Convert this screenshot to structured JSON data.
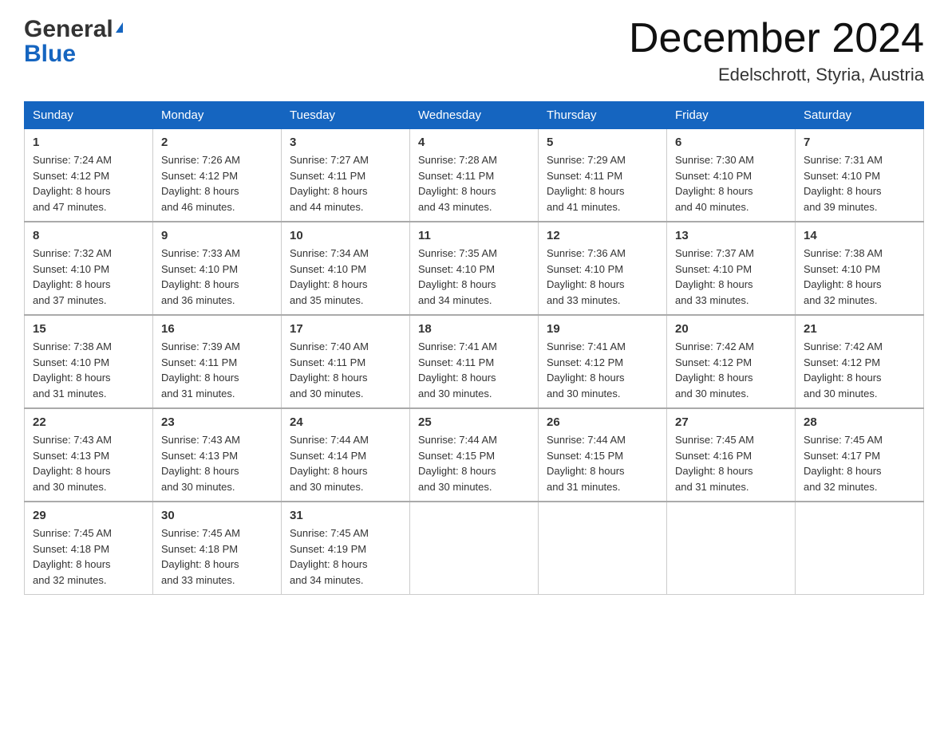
{
  "header": {
    "title": "December 2024",
    "subtitle": "Edelschrott, Styria, Austria",
    "logo_general": "General",
    "logo_blue": "Blue"
  },
  "days_of_week": [
    "Sunday",
    "Monday",
    "Tuesday",
    "Wednesday",
    "Thursday",
    "Friday",
    "Saturday"
  ],
  "weeks": [
    [
      {
        "day": "1",
        "sunrise": "7:24 AM",
        "sunset": "4:12 PM",
        "daylight": "8 hours and 47 minutes."
      },
      {
        "day": "2",
        "sunrise": "7:26 AM",
        "sunset": "4:12 PM",
        "daylight": "8 hours and 46 minutes."
      },
      {
        "day": "3",
        "sunrise": "7:27 AM",
        "sunset": "4:11 PM",
        "daylight": "8 hours and 44 minutes."
      },
      {
        "day": "4",
        "sunrise": "7:28 AM",
        "sunset": "4:11 PM",
        "daylight": "8 hours and 43 minutes."
      },
      {
        "day": "5",
        "sunrise": "7:29 AM",
        "sunset": "4:11 PM",
        "daylight": "8 hours and 41 minutes."
      },
      {
        "day": "6",
        "sunrise": "7:30 AM",
        "sunset": "4:10 PM",
        "daylight": "8 hours and 40 minutes."
      },
      {
        "day": "7",
        "sunrise": "7:31 AM",
        "sunset": "4:10 PM",
        "daylight": "8 hours and 39 minutes."
      }
    ],
    [
      {
        "day": "8",
        "sunrise": "7:32 AM",
        "sunset": "4:10 PM",
        "daylight": "8 hours and 37 minutes."
      },
      {
        "day": "9",
        "sunrise": "7:33 AM",
        "sunset": "4:10 PM",
        "daylight": "8 hours and 36 minutes."
      },
      {
        "day": "10",
        "sunrise": "7:34 AM",
        "sunset": "4:10 PM",
        "daylight": "8 hours and 35 minutes."
      },
      {
        "day": "11",
        "sunrise": "7:35 AM",
        "sunset": "4:10 PM",
        "daylight": "8 hours and 34 minutes."
      },
      {
        "day": "12",
        "sunrise": "7:36 AM",
        "sunset": "4:10 PM",
        "daylight": "8 hours and 33 minutes."
      },
      {
        "day": "13",
        "sunrise": "7:37 AM",
        "sunset": "4:10 PM",
        "daylight": "8 hours and 33 minutes."
      },
      {
        "day": "14",
        "sunrise": "7:38 AM",
        "sunset": "4:10 PM",
        "daylight": "8 hours and 32 minutes."
      }
    ],
    [
      {
        "day": "15",
        "sunrise": "7:38 AM",
        "sunset": "4:10 PM",
        "daylight": "8 hours and 31 minutes."
      },
      {
        "day": "16",
        "sunrise": "7:39 AM",
        "sunset": "4:11 PM",
        "daylight": "8 hours and 31 minutes."
      },
      {
        "day": "17",
        "sunrise": "7:40 AM",
        "sunset": "4:11 PM",
        "daylight": "8 hours and 30 minutes."
      },
      {
        "day": "18",
        "sunrise": "7:41 AM",
        "sunset": "4:11 PM",
        "daylight": "8 hours and 30 minutes."
      },
      {
        "day": "19",
        "sunrise": "7:41 AM",
        "sunset": "4:12 PM",
        "daylight": "8 hours and 30 minutes."
      },
      {
        "day": "20",
        "sunrise": "7:42 AM",
        "sunset": "4:12 PM",
        "daylight": "8 hours and 30 minutes."
      },
      {
        "day": "21",
        "sunrise": "7:42 AM",
        "sunset": "4:12 PM",
        "daylight": "8 hours and 30 minutes."
      }
    ],
    [
      {
        "day": "22",
        "sunrise": "7:43 AM",
        "sunset": "4:13 PM",
        "daylight": "8 hours and 30 minutes."
      },
      {
        "day": "23",
        "sunrise": "7:43 AM",
        "sunset": "4:13 PM",
        "daylight": "8 hours and 30 minutes."
      },
      {
        "day": "24",
        "sunrise": "7:44 AM",
        "sunset": "4:14 PM",
        "daylight": "8 hours and 30 minutes."
      },
      {
        "day": "25",
        "sunrise": "7:44 AM",
        "sunset": "4:15 PM",
        "daylight": "8 hours and 30 minutes."
      },
      {
        "day": "26",
        "sunrise": "7:44 AM",
        "sunset": "4:15 PM",
        "daylight": "8 hours and 31 minutes."
      },
      {
        "day": "27",
        "sunrise": "7:45 AM",
        "sunset": "4:16 PM",
        "daylight": "8 hours and 31 minutes."
      },
      {
        "day": "28",
        "sunrise": "7:45 AM",
        "sunset": "4:17 PM",
        "daylight": "8 hours and 32 minutes."
      }
    ],
    [
      {
        "day": "29",
        "sunrise": "7:45 AM",
        "sunset": "4:18 PM",
        "daylight": "8 hours and 32 minutes."
      },
      {
        "day": "30",
        "sunrise": "7:45 AM",
        "sunset": "4:18 PM",
        "daylight": "8 hours and 33 minutes."
      },
      {
        "day": "31",
        "sunrise": "7:45 AM",
        "sunset": "4:19 PM",
        "daylight": "8 hours and 34 minutes."
      },
      null,
      null,
      null,
      null
    ]
  ],
  "labels": {
    "sunrise": "Sunrise:",
    "sunset": "Sunset:",
    "daylight": "Daylight:"
  }
}
